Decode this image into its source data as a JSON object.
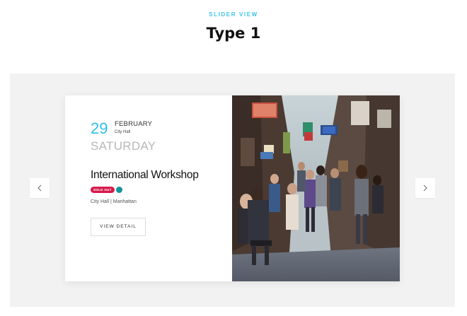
{
  "header": {
    "eyebrow": "SLIDER VIEW",
    "title": "Type 1"
  },
  "slider": {
    "prev_icon": "chevron-left-icon",
    "next_icon": "chevron-right-icon",
    "card": {
      "day": "29",
      "month": "FEBRUARY",
      "venue_small": "City Hall",
      "weekday": "SATURDAY",
      "title": "International Workshop",
      "badge": "SOLD OUT",
      "location": "City Hall | Manhattan",
      "button_label": "VIEW DETAIL",
      "image_alt": "Crowded city laneway with shops and pedestrians"
    }
  },
  "colors": {
    "accent": "#3fc3e6",
    "badge": "#d61b4d",
    "dot": "#14949a",
    "slider_bg": "#f2f2f2"
  }
}
